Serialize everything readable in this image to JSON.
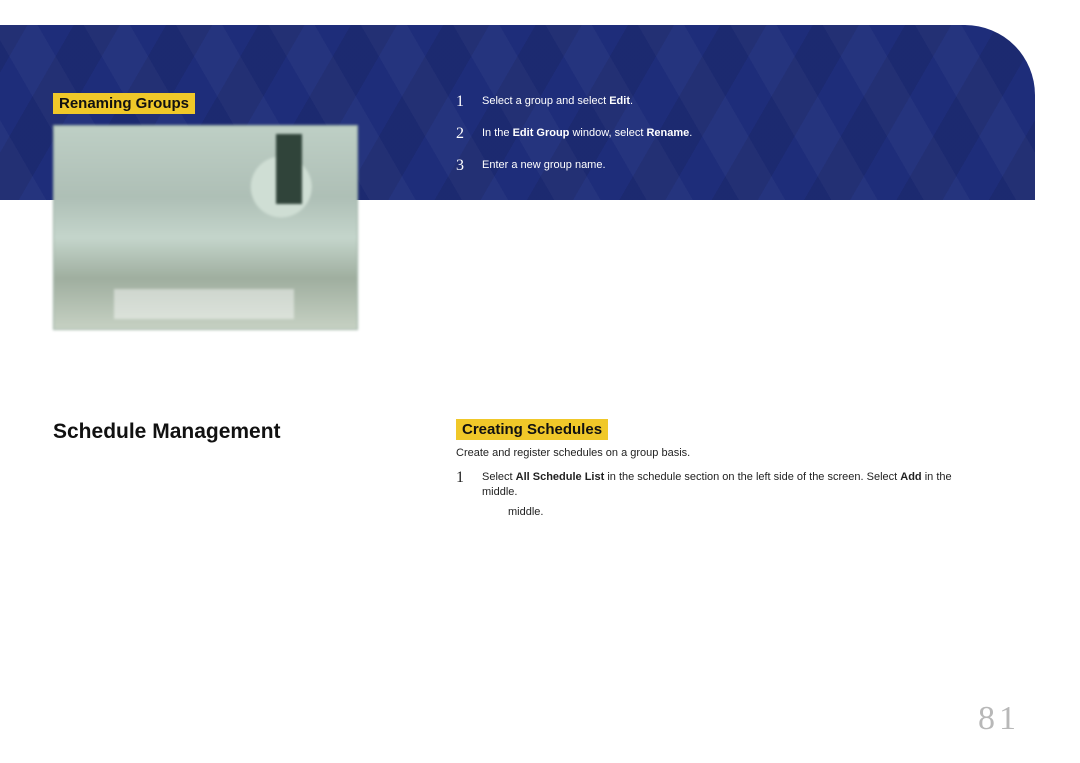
{
  "sections": {
    "renaming_title": "Renaming Groups",
    "creating_title": "Creating Schedules",
    "schedule_heading": "Schedule Management"
  },
  "rename_steps": {
    "s1_num": "1",
    "s1_a": "Select a group and select ",
    "s1_b": "Edit",
    "s1_c": ".",
    "s2_num": "2",
    "s2_a": "In the ",
    "s2_b": "Edit Group",
    "s2_c": " window, select ",
    "s2_d": "Rename",
    "s2_e": ".",
    "s3_num": "3",
    "s3_a": "Enter a new group name."
  },
  "create_intro": "Create and register schedules on a group basis.",
  "create_steps": {
    "s1_num": "1",
    "s1_a": "Select ",
    "s1_b": "All Schedule List",
    "s1_c": " in the schedule section on the left side of the screen. Select ",
    "s1_d": "Add",
    "s1_e": " in the middle.",
    "line2": "middle."
  },
  "page_number": "81"
}
